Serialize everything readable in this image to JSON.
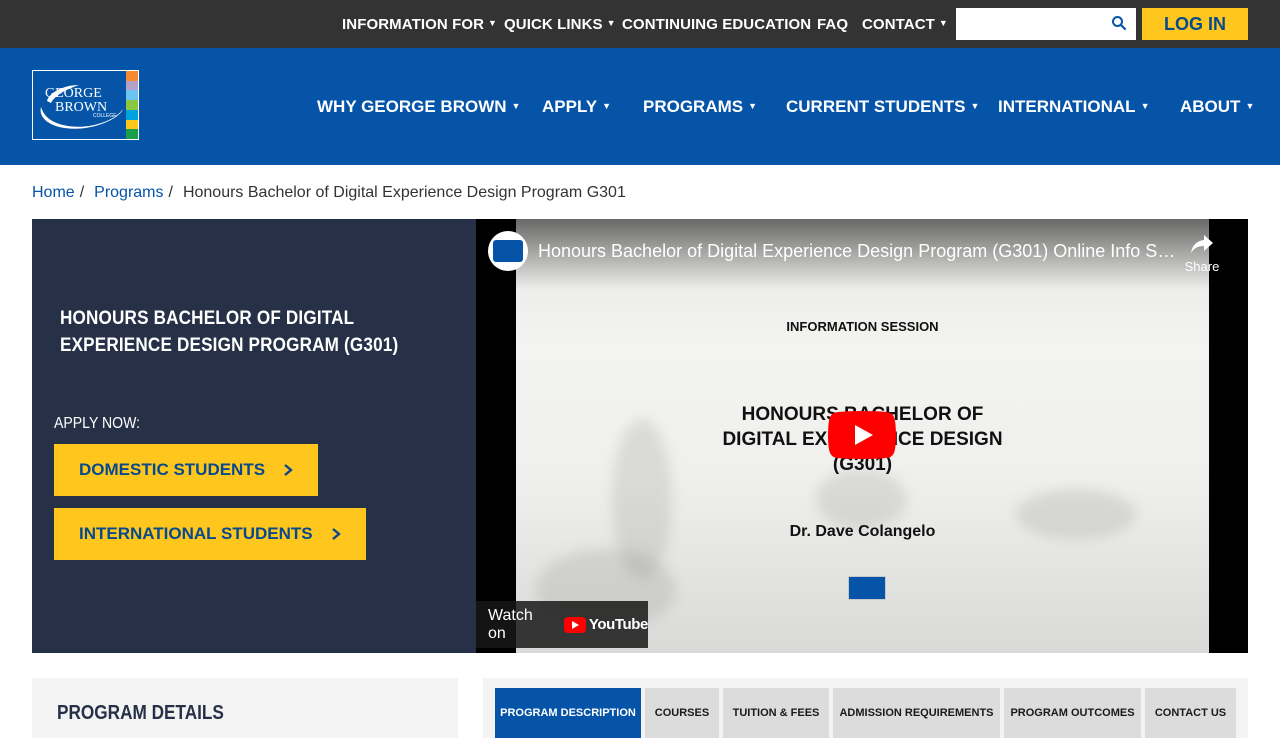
{
  "utility_nav": {
    "items": [
      {
        "label": "INFORMATION FOR",
        "has_dropdown": true
      },
      {
        "label": "QUICK LINKS",
        "has_dropdown": true
      },
      {
        "label": "CONTINUING EDUCATION",
        "has_dropdown": false
      },
      {
        "label": "FAQ",
        "has_dropdown": false
      },
      {
        "label": "CONTACT",
        "has_dropdown": true
      }
    ],
    "search": {
      "placeholder": "",
      "value": "",
      "icon": "search-icon"
    },
    "login_label": "LOG IN"
  },
  "header": {
    "logo_text": [
      "GEORGE",
      "BROWN",
      "COLLEGE"
    ],
    "logo_stripe_colors": [
      "#f58a33",
      "#b4a0c9",
      "#6cc4f0",
      "#8dc63f",
      "#00a3e0",
      "#ffc61e",
      "#1a9e4a"
    ],
    "main_nav": [
      {
        "label": "WHY GEORGE BROWN"
      },
      {
        "label": "APPLY"
      },
      {
        "label": "PROGRAMS"
      },
      {
        "label": "CURRENT STUDENTS"
      },
      {
        "label": "INTERNATIONAL"
      },
      {
        "label": "ABOUT"
      }
    ]
  },
  "breadcrumb": {
    "items": [
      {
        "label": "Home",
        "link": true
      },
      {
        "label": "Programs",
        "link": true
      },
      {
        "label": "Honours Bachelor of Digital Experience Design Program G301",
        "link": false
      }
    ]
  },
  "hero": {
    "title": "HONOURS BACHELOR OF DIGITAL EXPERIENCE DESIGN PROGRAM (G301)",
    "apply_now": "APPLY NOW:",
    "cta_domestic": "DOMESTIC STUDENTS",
    "cta_international": "INTERNATIONAL STUDENTS"
  },
  "video": {
    "title": "Honours Bachelor of Digital Experience Design Program (G301) Online Info Se...",
    "share_label": "Share",
    "slide_heading": "INFORMATION SESSION",
    "slide_title_line1": "HONOURS BACHELOR OF",
    "slide_title_line2": "DIGITAL EXPERIENCE DESIGN",
    "slide_title_line3": "(G301)",
    "slide_presenter": "Dr. Dave Colangelo",
    "watch_on_label": "Watch on",
    "youtube_label": "YouTube"
  },
  "program_details": {
    "title": "PROGRAM DETAILS"
  },
  "tabs": [
    {
      "label": "PROGRAM DESCRIPTION",
      "active": true
    },
    {
      "label": "COURSES",
      "active": false
    },
    {
      "label": "TUITION & FEES",
      "active": false
    },
    {
      "label": "ADMISSION REQUIREMENTS",
      "active": false
    },
    {
      "label": "PROGRAM OUTCOMES",
      "active": false
    },
    {
      "label": "CONTACT US",
      "active": false
    }
  ],
  "colors": {
    "utility_bg": "#333333",
    "header_blue": "#0554a8",
    "accent_yellow": "#ffc61e",
    "hero_navy": "#263147"
  }
}
